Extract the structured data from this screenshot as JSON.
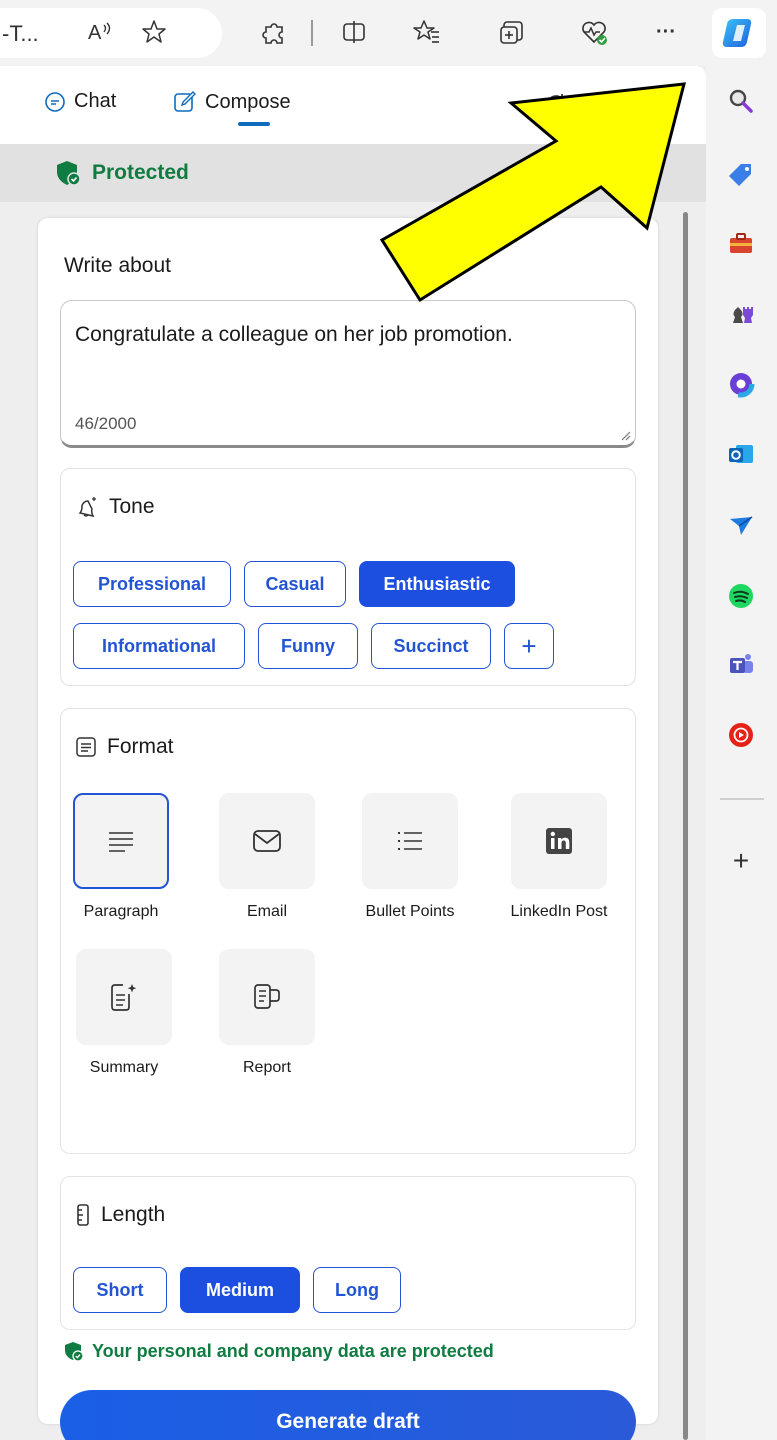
{
  "toolbar": {
    "address_text": "-T...",
    "read_aloud_icon": "read-aloud-icon",
    "favorite_icon": "star-icon",
    "extensions_icon": "puzzle-icon",
    "split_icon": "split-screen-icon",
    "favorites_icon": "favorites-icon",
    "collections_icon": "collections-icon",
    "health_icon": "browser-essentials-icon",
    "more_label": "···"
  },
  "tabs": {
    "chat": "Chat",
    "compose": "Compose"
  },
  "protected_label": "Protected",
  "write_about": {
    "label": "Write about",
    "value": "Congratulate a colleague on her job promotion.",
    "counter": "46/2000"
  },
  "tone": {
    "title": "Tone",
    "options": [
      "Professional",
      "Casual",
      "Enthusiastic",
      "Informational",
      "Funny",
      "Succinct",
      "+"
    ],
    "selected": "Enthusiastic"
  },
  "format": {
    "title": "Format",
    "options": [
      "Paragraph",
      "Email",
      "Bullet Points",
      "LinkedIn Post",
      "Summary",
      "Report"
    ],
    "selected": "Paragraph"
  },
  "length": {
    "title": "Length",
    "options": [
      "Short",
      "Medium",
      "Long"
    ],
    "selected": "Medium"
  },
  "privacy_note": "Your personal and company data are protected",
  "generate_label": "Generate draft",
  "rail": {
    "items": [
      "search-icon",
      "shopping-tag-icon",
      "tools-icon",
      "games-icon",
      "microsoft-365-icon",
      "outlook-icon",
      "telegram-icon",
      "spotify-icon",
      "teams-icon",
      "youtube-music-icon"
    ],
    "add_label": "+"
  },
  "colors": {
    "accent": "#2354d4",
    "selected_chip": "#1c4fe0",
    "protected_green": "#107c41",
    "arrow_fill": "#ffff00"
  }
}
